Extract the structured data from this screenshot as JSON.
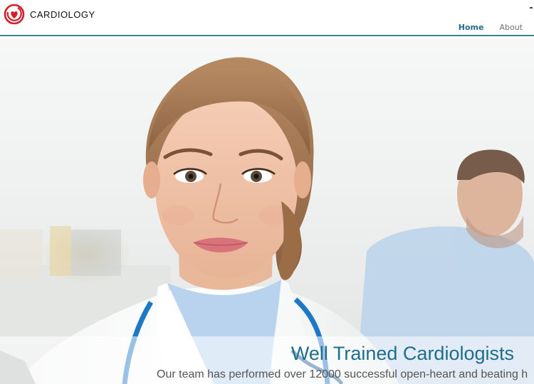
{
  "brand": {
    "name": "CARDIOLOGY",
    "logo_icon": "heart-logo-icon",
    "accent_color": "#d21f2a"
  },
  "nav": {
    "items": [
      {
        "label": "Home",
        "active": true
      },
      {
        "label": "About",
        "active": false
      }
    ],
    "active_color": "#1f6f8b"
  },
  "hero": {
    "image": "female-doctor-with-patient-photo",
    "caption_title": "Well Trained Cardiologists",
    "caption_text": "Our team has performed over 12000 successful open-heart and beating h",
    "title_color": "#1d6e8c"
  }
}
